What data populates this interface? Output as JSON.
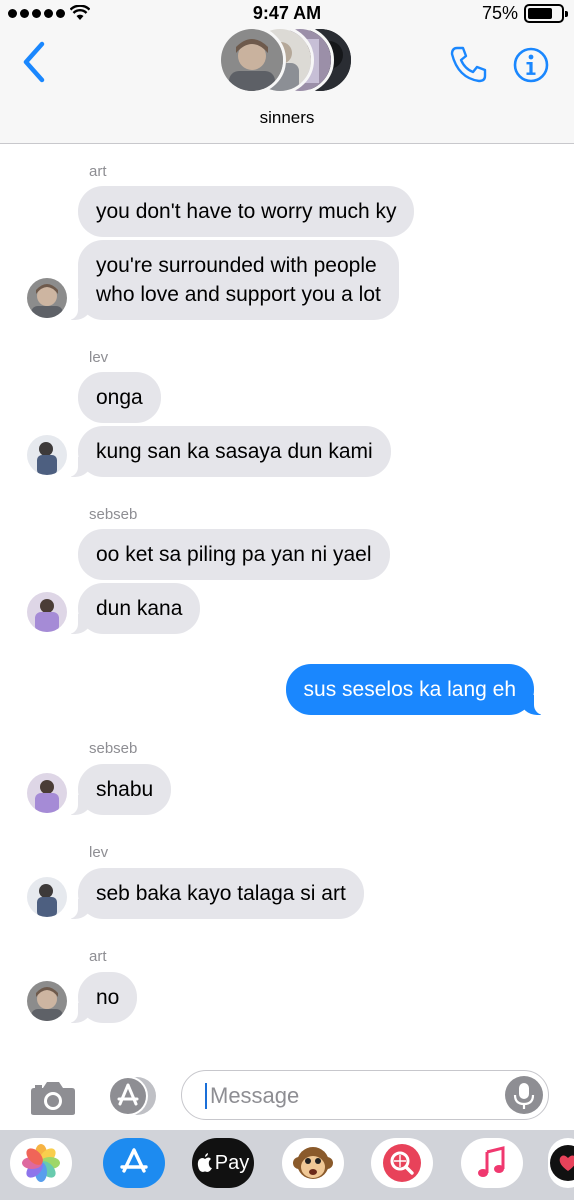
{
  "status_bar": {
    "time": "9:47 AM",
    "battery_percent": "75%",
    "battery_level": 0.75,
    "signal_bars": 5
  },
  "header": {
    "group_name": "sinners",
    "icons": [
      "chevron-left-icon",
      "phone-icon",
      "info-icon"
    ]
  },
  "colors": {
    "accent": "#1a87fe",
    "received_bubble": "#e5e5ea",
    "sender_label": "#8e8e93"
  },
  "messages": [
    {
      "sender": "art",
      "text": "you don't have to worry much ky"
    },
    {
      "text_lines": [
        "you're surrounded with people",
        "who love and support you a lot"
      ]
    },
    {
      "sender": "lev",
      "text": "onga"
    },
    {
      "text": "kung san ka sasaya dun kami"
    },
    {
      "sender": "sebseb",
      "text": "oo ket sa piling pa yan ni yael"
    },
    {
      "text": "dun kana"
    },
    {
      "sent": true,
      "text": "sus seselos ka lang eh"
    },
    {
      "sender": "sebseb",
      "text": "shabu"
    },
    {
      "sender": "lev",
      "text": "seb baka kayo talaga si art"
    },
    {
      "sender": "art",
      "text": "no"
    }
  ],
  "input": {
    "placeholder": "Message"
  },
  "app_drawer": {
    "apple_pay_label": "Pay",
    "apps": [
      "photos-icon",
      "app-store-icon",
      "apple-pay-icon",
      "animoji-monkey-icon",
      "image-search-icon",
      "music-icon",
      "heart-app-icon"
    ]
  }
}
